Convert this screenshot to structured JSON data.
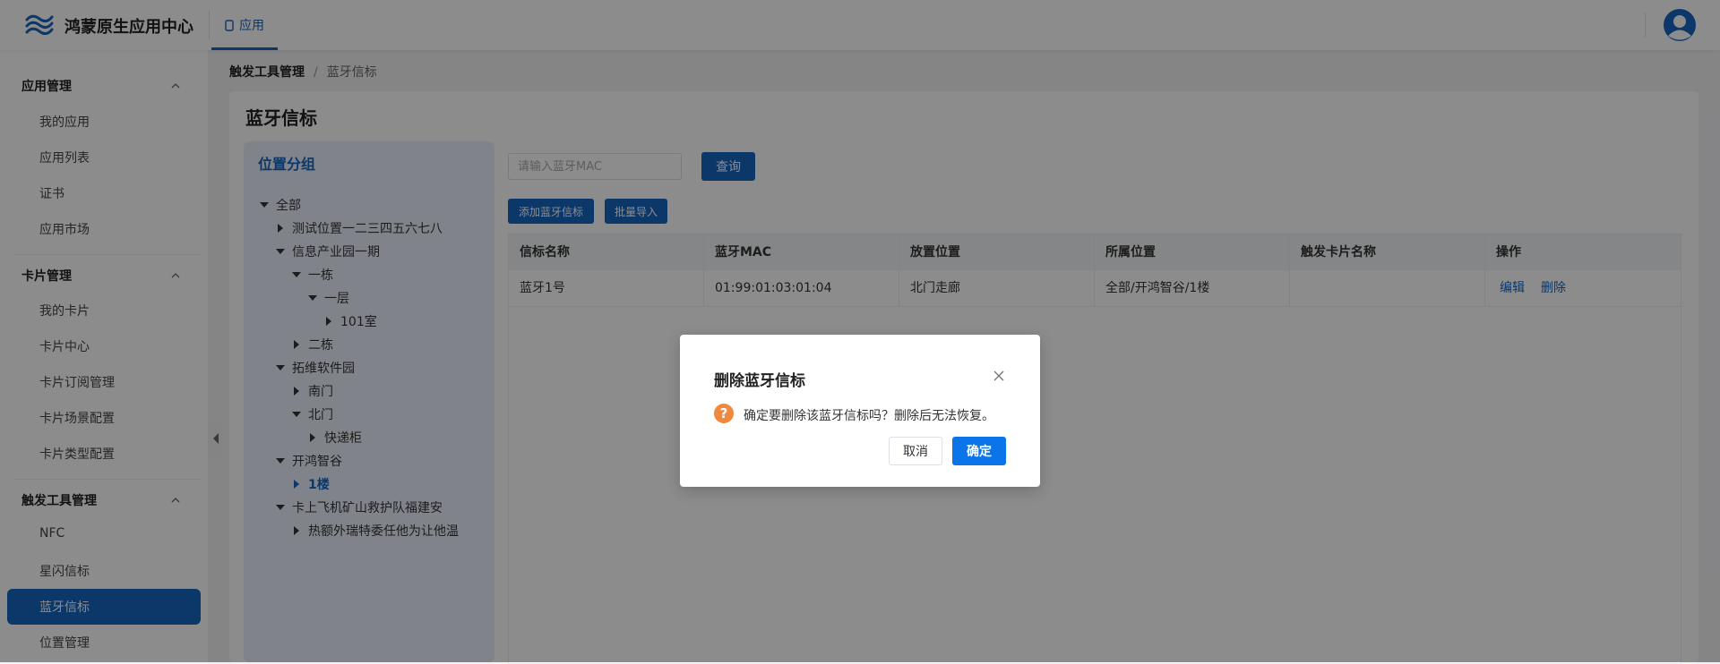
{
  "header": {
    "brand": "鸿蒙原生应用中心",
    "tab_app": "应用",
    "logo_icon": "wave-logo-icon",
    "avatar_icon": "user-avatar-icon",
    "accent_color": "#1565c0"
  },
  "sidebar": {
    "groups": [
      {
        "title": "应用管理",
        "items": [
          "我的应用",
          "应用列表",
          "证书",
          "应用市场"
        ]
      },
      {
        "title": "卡片管理",
        "items": [
          "我的卡片",
          "卡片中心",
          "卡片订阅管理",
          "卡片场景配置",
          "卡片类型配置"
        ]
      },
      {
        "title": "触发工具管理",
        "items": [
          "NFC",
          "星闪信标",
          "蓝牙信标",
          "位置管理"
        ]
      }
    ],
    "active_item": "蓝牙信标"
  },
  "breadcrumb": {
    "parent": "触发工具管理",
    "separator": "/",
    "current": "蓝牙信标"
  },
  "page": {
    "title": "蓝牙信标"
  },
  "location_panel": {
    "title": "位置分组",
    "tree": [
      {
        "label": "全部",
        "expanded": true
      },
      {
        "label": "测试位置一二三四五六七八",
        "expanded": false
      },
      {
        "label": "信息产业园一期",
        "expanded": true
      },
      {
        "label": "一栋",
        "expanded": true
      },
      {
        "label": "一层",
        "expanded": true
      },
      {
        "label": "101室",
        "expanded": false
      },
      {
        "label": "二栋",
        "expanded": false
      },
      {
        "label": "拓维软件园",
        "expanded": true
      },
      {
        "label": "南门",
        "expanded": false
      },
      {
        "label": "北门",
        "expanded": true
      },
      {
        "label": "快递柜",
        "expanded": false
      },
      {
        "label": "开鸿智谷",
        "expanded": true
      },
      {
        "label": "1楼",
        "expanded": false,
        "selected": true
      },
      {
        "label": "卡上飞机矿山救护队福建安",
        "expanded": true
      },
      {
        "label": "热额外瑞特委任他为让他温",
        "expanded": false
      }
    ]
  },
  "search": {
    "placeholder": "请输入蓝牙MAC",
    "value": "",
    "query_label": "查询"
  },
  "toolbar": {
    "add_label": "添加蓝牙信标",
    "import_label": "批量导入"
  },
  "table": {
    "columns": [
      "信标名称",
      "蓝牙MAC",
      "放置位置",
      "所属位置",
      "触发卡片名称",
      "操作"
    ],
    "rows": [
      {
        "name": "蓝牙1号",
        "mac": "01:99:01:03:01:04",
        "placement": "北门走廊",
        "location": "全部/开鸿智谷/1楼",
        "card": "",
        "actions": [
          "编辑",
          "删除"
        ]
      }
    ]
  },
  "modal": {
    "title": "删除蓝牙信标",
    "message": "确定要删除该蓝牙信标吗？删除后无法恢复。",
    "cancel_label": "取消",
    "ok_label": "确定",
    "warning_color": "#f0883e",
    "icon": "question-icon",
    "icon_glyph": "?"
  }
}
